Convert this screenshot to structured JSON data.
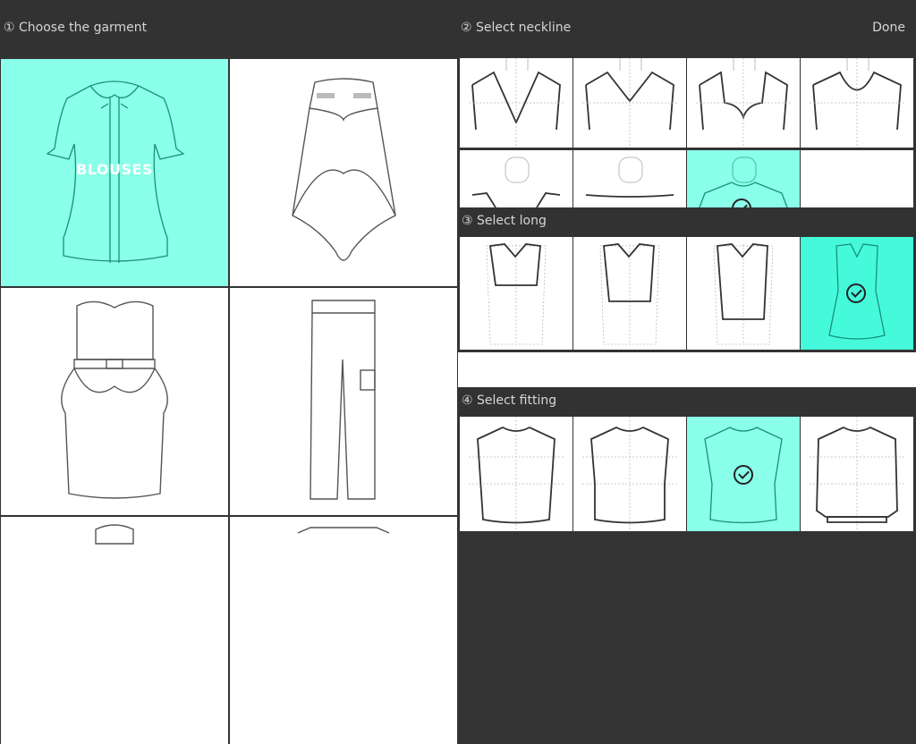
{
  "header": {
    "step1_title": "① Choose the garment",
    "step2_title": "② Select neckline",
    "done_label": "Done"
  },
  "garments": [
    {
      "name": "blouses",
      "label": "BLOUSES",
      "selected": true
    },
    {
      "name": "skirt",
      "label": "",
      "selected": false
    },
    {
      "name": "dress",
      "label": "",
      "selected": false
    },
    {
      "name": "pants",
      "label": "",
      "selected": false
    },
    {
      "name": "garment-5",
      "label": "",
      "selected": false
    },
    {
      "name": "garment-6",
      "label": "",
      "selected": false
    }
  ],
  "neckline": {
    "options": [
      "deep-v",
      "v-neck",
      "sweetheart",
      "round",
      "boat-v",
      "boat",
      "crew",
      "empty"
    ],
    "selected_index": 6
  },
  "long": {
    "title": "③ Select long",
    "options": [
      "cropped",
      "waist",
      "hip",
      "tunic"
    ],
    "selected_index": 3
  },
  "fitting": {
    "title": "④ Select fitting",
    "options": [
      "straight",
      "semi-fitted",
      "fitted",
      "elastic-hem"
    ],
    "selected_index": 2
  },
  "colors": {
    "selected": "#8affe9",
    "selected_strong": "#44fadb",
    "header_bg": "#323232"
  }
}
